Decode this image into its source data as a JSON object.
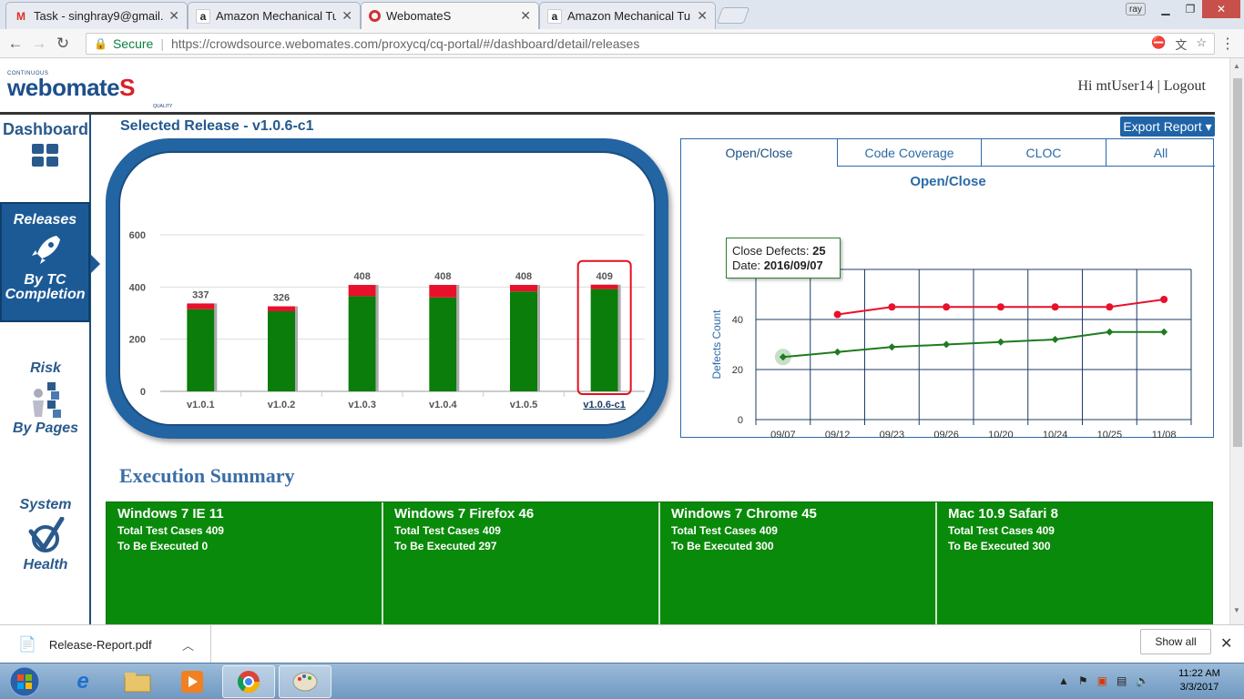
{
  "browser": {
    "tabs": [
      {
        "title": "Task - singhray9@gmail.c",
        "icon": "gmail-icon",
        "active": false
      },
      {
        "title": "Amazon Mechanical Turk",
        "icon": "amazon-icon",
        "active": false
      },
      {
        "title": "WebomateS",
        "icon": "webomates-icon",
        "active": true
      },
      {
        "title": "Amazon Mechanical Turk",
        "icon": "amazon-icon",
        "active": false
      }
    ],
    "window_user": "ray",
    "secure_label": "Secure",
    "url": "https://crowdsource.webomates.com/proxycq/cq-portal/#/dashboard/detail/releases"
  },
  "header": {
    "logo_small": "CONTINUOUS",
    "logo_main": "webomate",
    "logo_s": "S",
    "logo_quality": "QUALITY",
    "greeting": "Hi mtUser14",
    "separator": "|",
    "logout": "Logout"
  },
  "sidebar": {
    "dashboard": "Dashboard",
    "releases": "Releases",
    "by_tc_1": "By TC",
    "by_tc_2": "Completion",
    "risk": "Risk",
    "by_pages": "By Pages",
    "system": "System",
    "health": "Health"
  },
  "main": {
    "selected_release": "Selected Release - v1.0.6-c1",
    "export_button": "Export Report ▾"
  },
  "bar_chart": {
    "chart_data": {
      "type": "bar",
      "categories": [
        "v1.0.1",
        "v1.0.2",
        "v1.0.3",
        "v1.0.4",
        "v1.0.5",
        "v1.0.6-c1"
      ],
      "totals": [
        337,
        326,
        408,
        408,
        408,
        409
      ],
      "series": [
        {
          "values": [
            315,
            307,
            365,
            360,
            383,
            392
          ],
          "color": "#0a7d0a"
        },
        {
          "values": [
            22,
            19,
            43,
            48,
            25,
            17
          ],
          "color": "#e8102a"
        }
      ],
      "yticks": [
        "0",
        "200",
        "400",
        "600"
      ],
      "ylim": [
        0,
        600
      ],
      "selected_index": 5
    }
  },
  "line_panel": {
    "tabs": [
      "Open/Close",
      "Code Coverage",
      "CLOC",
      "All"
    ],
    "active_tab": 0,
    "title": "Open/Close",
    "chart_data": {
      "type": "line",
      "categories": [
        "09/07",
        "09/12",
        "09/23",
        "09/26",
        "10/20",
        "10/24",
        "10/25",
        "11/08"
      ],
      "series": [
        {
          "values": [
            null,
            42,
            45,
            45,
            45,
            45,
            45,
            48
          ],
          "color": "#e8102a"
        },
        {
          "values": [
            25,
            27,
            29,
            30,
            31,
            32,
            35,
            35
          ],
          "color": "#1e7b1e"
        }
      ],
      "yticks": [
        "0",
        "20",
        "40",
        "60"
      ],
      "ylim": [
        0,
        60
      ],
      "xlabel": "Date",
      "ylabel": "Defects Count"
    },
    "tooltip": {
      "label1": "Close Defects:",
      "value1": "25",
      "label2": "Date:",
      "value2": "2016/09/07"
    }
  },
  "execution": {
    "title": "Execution Summary",
    "cells": [
      {
        "name": "Windows 7 IE 11",
        "total": "Total Test Cases 409",
        "pending": "To Be Executed 0"
      },
      {
        "name": "Windows 7 Firefox 46",
        "total": "Total Test Cases 409",
        "pending": "To Be Executed 297"
      },
      {
        "name": "Windows 7 Chrome 45",
        "total": "Total Test Cases 409",
        "pending": "To Be Executed 300"
      },
      {
        "name": "Mac 10.9 Safari 8",
        "total": "Total Test Cases 409",
        "pending": "To Be Executed 300"
      }
    ]
  },
  "download": {
    "file": "Release-Report.pdf",
    "show_all": "Show all"
  },
  "taskbar": {
    "time": "11:22 AM",
    "date": "3/3/2017"
  }
}
